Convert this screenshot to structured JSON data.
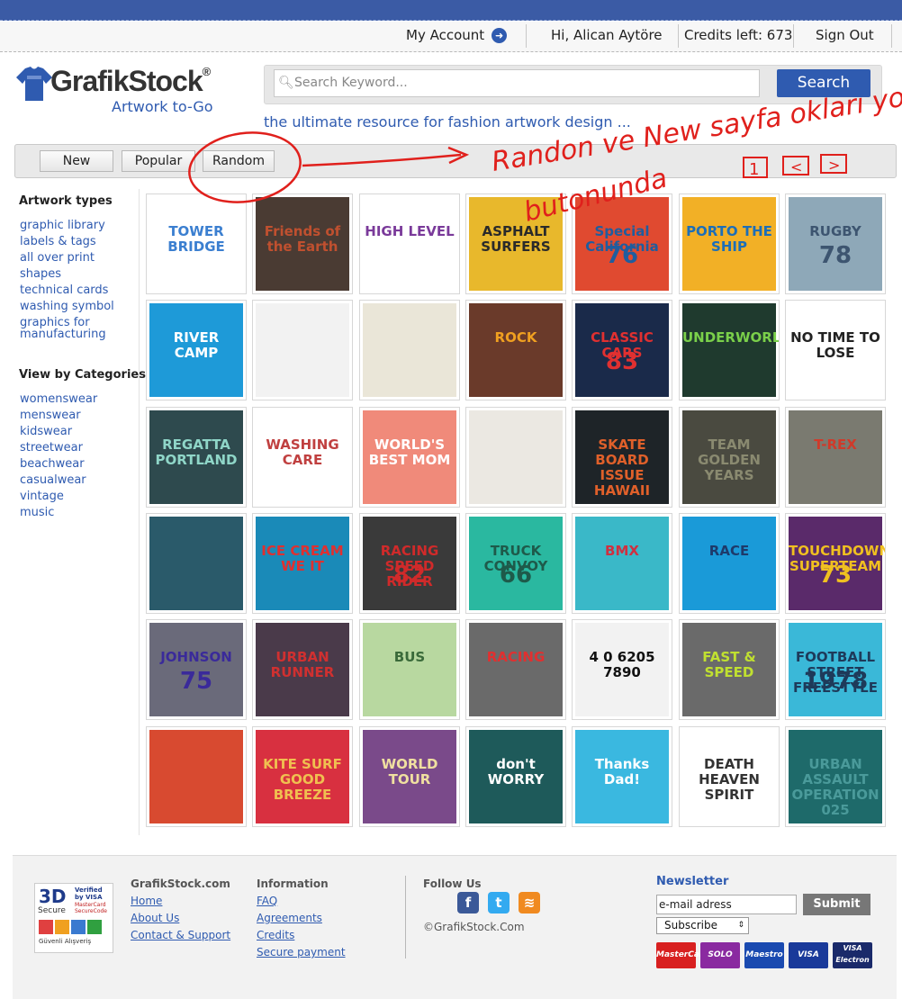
{
  "account_bar": {
    "my_account": "My Account",
    "greeting": "Hi, Alican Aytöre",
    "credits": "Credits left: 673",
    "sign_out": "Sign Out"
  },
  "header": {
    "logo_text": "GrafikStock",
    "logo_tagline": "Artwork to-Go",
    "search_placeholder": "Search Keyword...",
    "search_button": "Search",
    "slogan": "the ultimate resource for fashion artwork design ..."
  },
  "tabs": [
    "New",
    "Popular",
    "Random"
  ],
  "annotation": {
    "line1": "Randon ve New sayfa okları yok",
    "line2": "butonunda",
    "pager": [
      "1",
      "<",
      ">"
    ]
  },
  "sidebar": {
    "artwork_types_heading": "Artwork types",
    "artwork_types": [
      "graphic library",
      "labels & tags",
      "all over print",
      "shapes",
      "technical cards",
      "washing symbol",
      "graphics for manufacturing"
    ],
    "categories_heading": "View by Categories",
    "categories": [
      "womenswear",
      "menswear",
      "kidswear",
      "streetwear",
      "beachwear",
      "casualwear",
      "vintage",
      "music"
    ]
  },
  "artworks": [
    {
      "bg": "#ffffff",
      "fg": "#3b7fd0",
      "text": "TOWER BRIDGE",
      "num": ""
    },
    {
      "bg": "#4a3b33",
      "fg": "#c0502f",
      "text": "Friends of the Earth",
      "num": ""
    },
    {
      "bg": "#ffffff",
      "fg": "#7a3a9a",
      "text": "HIGH LEVEL",
      "num": ""
    },
    {
      "bg": "#e8b82c",
      "fg": "#2a2a2a",
      "text": "ASPHALT SURFERS",
      "num": ""
    },
    {
      "bg": "#e04a30",
      "fg": "#1f5d9e",
      "text": "Special California",
      "num": "76"
    },
    {
      "bg": "#f2b026",
      "fg": "#1c6eb8",
      "text": "PORTO THE SHIP",
      "num": ""
    },
    {
      "bg": "#8ea8b8",
      "fg": "#3d5570",
      "text": "RUGBY",
      "num": "78"
    },
    {
      "bg": "#1e9ad8",
      "fg": "#ffffff",
      "text": "RIVER CAMP",
      "num": ""
    },
    {
      "bg": "#f2f2f2",
      "fg": "#555555",
      "text": "",
      "num": ""
    },
    {
      "bg": "#eae6d8",
      "fg": "#aaaaaa",
      "text": "",
      "num": ""
    },
    {
      "bg": "#6a3a2a",
      "fg": "#f0a020",
      "text": "ROCK",
      "num": ""
    },
    {
      "bg": "#1a2a4a",
      "fg": "#e03030",
      "text": "CLASSIC CARS",
      "num": "83"
    },
    {
      "bg": "#1f3a2e",
      "fg": "#7ad04a",
      "text": "UNDERWORLD",
      "num": ""
    },
    {
      "bg": "#ffffff",
      "fg": "#222222",
      "text": "NO TIME TO LOSE",
      "num": ""
    },
    {
      "bg": "#2e4a4e",
      "fg": "#8fd6c8",
      "text": "REGATTA PORTLAND",
      "num": ""
    },
    {
      "bg": "#ffffff",
      "fg": "#c04040",
      "text": "WASHING CARE",
      "num": ""
    },
    {
      "bg": "#f08a7a",
      "fg": "#ffffff",
      "text": "WORLD'S BEST MOM",
      "num": ""
    },
    {
      "bg": "#ebe8e2",
      "fg": "#999999",
      "text": "",
      "num": ""
    },
    {
      "bg": "#1e2428",
      "fg": "#e0602a",
      "text": "SKATE BOARD ISSUE HAWAII",
      "num": ""
    },
    {
      "bg": "#4a4a40",
      "fg": "#8a8a70",
      "text": "TEAM GOLDEN YEARS",
      "num": ""
    },
    {
      "bg": "#7a7a70",
      "fg": "#d03a2a",
      "text": "T-REX",
      "num": ""
    },
    {
      "bg": "#2a5a6a",
      "fg": "#c0c0c0",
      "text": "",
      "num": ""
    },
    {
      "bg": "#1a8ab8",
      "fg": "#e03030",
      "text": "ICE CREAM WE IT",
      "num": ""
    },
    {
      "bg": "#3a3a3a",
      "fg": "#d02a2a",
      "text": "RACING SPEED RIDER",
      "num": "82"
    },
    {
      "bg": "#2ab8a0",
      "fg": "#1e5a4a",
      "text": "TRUCK CONVOY",
      "num": "66"
    },
    {
      "bg": "#3ab8c8",
      "fg": "#d03040",
      "text": "BMX",
      "num": ""
    },
    {
      "bg": "#1a9ad8",
      "fg": "#1e3a6a",
      "text": "RACE",
      "num": ""
    },
    {
      "bg": "#5a2a6a",
      "fg": "#f0c020",
      "text": "TOUCHDOWN SUPERTEAM",
      "num": "73"
    },
    {
      "bg": "#6a6a7a",
      "fg": "#3a2a9a",
      "text": "JOHNSON",
      "num": "75"
    },
    {
      "bg": "#4a3a4a",
      "fg": "#d03030",
      "text": "URBAN RUNNER",
      "num": ""
    },
    {
      "bg": "#b8d8a0",
      "fg": "#3a6a3a",
      "text": "BUS",
      "num": ""
    },
    {
      "bg": "#6a6a6a",
      "fg": "#e03030",
      "text": "RACING",
      "num": ""
    },
    {
      "bg": "#f2f2f2",
      "fg": "#111111",
      "text": "4 0 6205 7890",
      "num": ""
    },
    {
      "bg": "#6a6a6a",
      "fg": "#c0e030",
      "text": "FAST & SPEED",
      "num": ""
    },
    {
      "bg": "#3ab8d8",
      "fg": "#1e3a5a",
      "text": "FOOTBALL STREET FREESTYLE",
      "num": "1978"
    },
    {
      "bg": "#d84a30",
      "fg": "#f0d8a0",
      "text": "",
      "num": ""
    },
    {
      "bg": "#d83040",
      "fg": "#f0c050",
      "text": "KITE SURF GOOD BREEZE",
      "num": ""
    },
    {
      "bg": "#7a4a8a",
      "fg": "#f0e0a0",
      "text": "WORLD TOUR",
      "num": ""
    },
    {
      "bg": "#1e5a5a",
      "fg": "#ffffff",
      "text": "don't WORRY",
      "num": ""
    },
    {
      "bg": "#3ab8e0",
      "fg": "#ffffff",
      "text": "Thanks Dad!",
      "num": ""
    },
    {
      "bg": "#ffffff",
      "fg": "#333333",
      "text": "DEATH HEAVEN SPIRIT",
      "num": ""
    },
    {
      "bg": "#1e6a6a",
      "fg": "#4a9a9a",
      "text": "URBAN ASSAULT OPERATION 025",
      "num": ""
    }
  ],
  "footer": {
    "badge_3d": "3D",
    "badge_secure": "Secure",
    "badge_verified": "Verified by VISA",
    "badge_mastercard": "MasterCard SecureCode",
    "badge_guvenli": "Güvenli Alışveriş",
    "col1_heading": "GrafikStock.com",
    "col1_links": [
      "Home",
      "About Us",
      "Contact & Support"
    ],
    "col2_heading": "Information",
    "col2_links": [
      "FAQ",
      "Agreements",
      "Credits",
      "Secure payment"
    ],
    "follow_heading": "Follow Us",
    "copyright": "©GrafikStock.Com",
    "newsletter_heading": "Newsletter",
    "newsletter_value": "e-mail adress",
    "newsletter_submit": "Submit",
    "subscribe_option": "Subscribe",
    "cards": [
      "MasterCard",
      "SOLO",
      "Maestro",
      "VISA",
      "VISA Electron"
    ]
  },
  "colors": {
    "brand_blue": "#2f5bb0",
    "annotation_red": "#e0201c"
  }
}
